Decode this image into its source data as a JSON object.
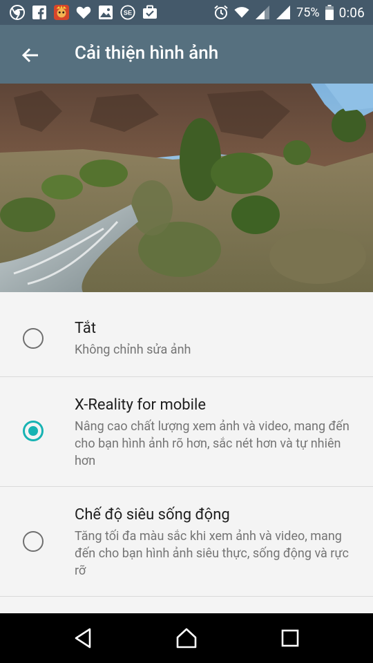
{
  "status_bar": {
    "battery": "75%",
    "time": "0:06",
    "icons": [
      "chrome-icon",
      "facebook-icon",
      "game-app-icon",
      "heart-icon",
      "gallery-icon",
      "settings-app-icon",
      "briefcase-icon",
      "alarm-icon",
      "wifi-icon",
      "signal-icon",
      "signal-icon",
      "battery-icon"
    ]
  },
  "app_bar": {
    "title": "Cải thiện hình ảnh",
    "back_icon": "arrow-back-icon"
  },
  "options": [
    {
      "title": "Tắt",
      "description": "Không chỉnh sửa ảnh",
      "selected": false
    },
    {
      "title": "X-Reality for mobile",
      "description": "Nâng cao chất lượng xem ảnh và video, mang đến cho bạn hình ảnh rõ hơn, sắc nét hơn và tự nhiên hơn",
      "selected": true
    },
    {
      "title": "Chế độ siêu sống động",
      "description": "Tăng tối đa màu sắc khi xem ảnh và video, mang đến cho bạn hình ảnh siêu thực, sống động và rực rỡ",
      "selected": false
    }
  ],
  "colors": {
    "app_bar": "#56707f",
    "status_bar": "#44596a",
    "accent": "#17b3b3"
  },
  "nav_bar": {
    "back_icon": "nav-back-icon",
    "home_icon": "nav-home-icon",
    "recents_icon": "nav-recents-icon"
  }
}
